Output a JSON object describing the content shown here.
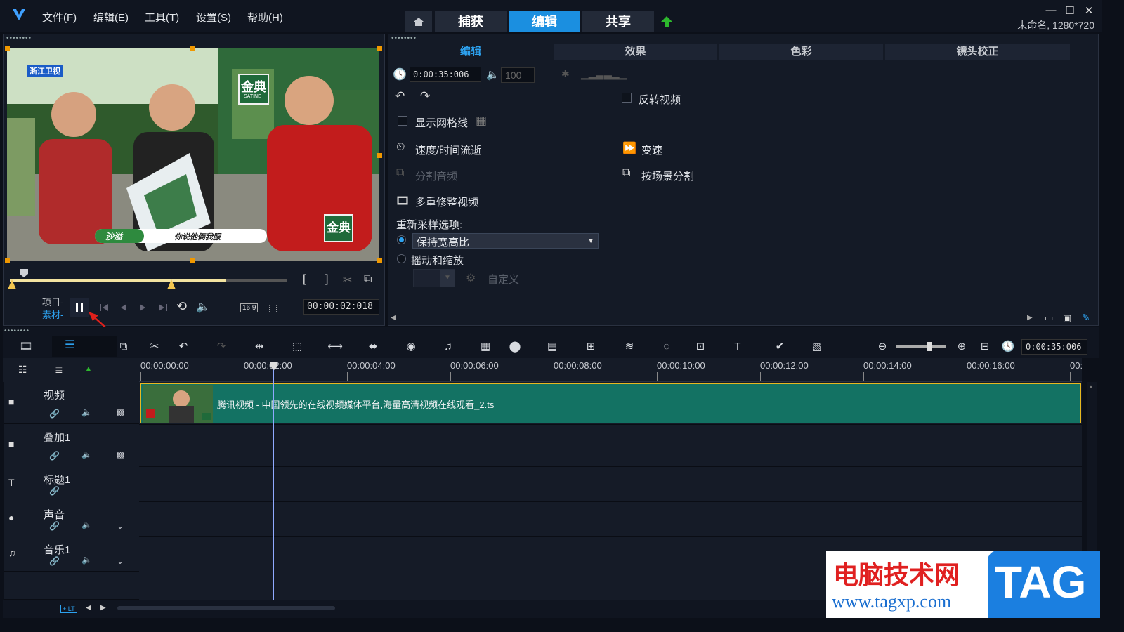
{
  "menu": {
    "file": "文件(F)",
    "edit": "编辑(E)",
    "tools": "工具(T)",
    "settings": "设置(S)",
    "help": "帮助(H)"
  },
  "workspace_tabs": {
    "capture": "捕获",
    "edit": "编辑",
    "share": "共享"
  },
  "project_info": "未命名, 1280*720",
  "preview": {
    "project_label": "项目-",
    "clip_label": "素材-",
    "timecode": "00:00:02:018",
    "aspect": "16:9",
    "pause_tooltip": "暂停",
    "video_logo": "浙江卫视",
    "brand1": "金典",
    "brand_small": "SATINE",
    "brand2": "金典",
    "caption_name": "沙溢",
    "caption_text": "你说他俩我服",
    "scrub_progress": 0.78
  },
  "options_panel": {
    "tabs": [
      "编辑",
      "效果",
      "色彩",
      "镜头校正"
    ],
    "duration": "0:00:35:006",
    "volume": "100",
    "reverse_video": "反转视频",
    "show_grid": "显示网格线",
    "speed_time_lapse": "速度/时间流逝",
    "variable_speed": "变速",
    "split_audio": "分割音频",
    "split_by_scene": "按场景分割",
    "multi_trim": "多重修整视频",
    "resample_label": "重新采样选项:",
    "keep_aspect": "保持宽高比",
    "pan_zoom": "摇动和缩放",
    "custom": "自定义"
  },
  "timeline": {
    "duration": "0:00:35:006",
    "zoom_level": 0.7,
    "ruler": [
      "00:00:00:00",
      "00:00:02:00",
      "00:00:04:00",
      "00:00:06:00",
      "00:00:08:00",
      "00:00:10:00",
      "00:00:12:00",
      "00:00:14:00",
      "00:00:16:00",
      "00:"
    ],
    "tracks": [
      {
        "name": "视频"
      },
      {
        "name": "叠加1"
      },
      {
        "name": "标题1"
      },
      {
        "name": "声音"
      },
      {
        "name": "音乐1"
      }
    ],
    "clip_title": "腾讯视频 - 中国领先的在线视频媒体平台,海量高清视频在线观看_2.ts",
    "scroll_button": "+ LT"
  },
  "watermark": {
    "title": "电脑技术网",
    "url": "www.tagxp.com",
    "tag": "TAG"
  },
  "colors": {
    "accent": "#1b8fe0",
    "clip": "#137263",
    "handle": "#f09800"
  }
}
